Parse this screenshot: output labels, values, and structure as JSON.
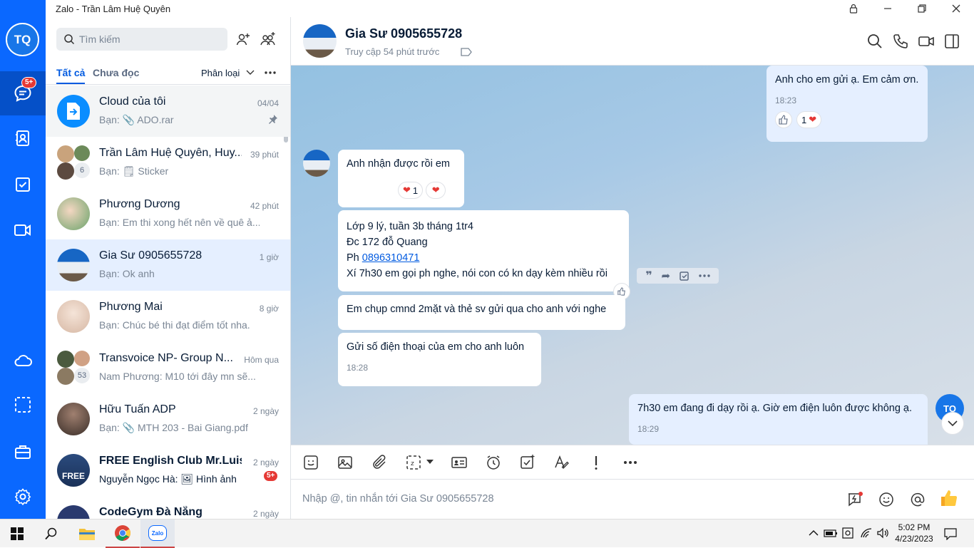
{
  "window": {
    "title": "Zalo - Trần Lâm Huệ Quyên"
  },
  "nav": {
    "avatar_initials": "TQ",
    "chat_badge": "5+"
  },
  "search": {
    "placeholder": "Tìm kiếm"
  },
  "tabs": {
    "all": "Tất cả",
    "unread": "Chưa đọc",
    "classify": "Phân loại"
  },
  "conversations": [
    {
      "name": "Cloud của tôi",
      "time": "04/04",
      "preview": "Bạn: 📎 ADO.rar",
      "pinned": true
    },
    {
      "name": "Trần Lâm Huệ Quyên, Huy...",
      "time": "39 phút",
      "preview": "Bạn: 🗒 Sticker",
      "count": "6"
    },
    {
      "name": "Phương Dương",
      "time": "42 phút",
      "preview": "Bạn: Em thi xong hết nên về quê ả..."
    },
    {
      "name": "Gia Sư 0905655728",
      "time": "1 giờ",
      "preview": "Bạn: Ok anh"
    },
    {
      "name": "Phương Mai",
      "time": "8 giờ",
      "preview": "Bạn: Chúc bé thi đạt điểm tốt nha."
    },
    {
      "name": "Transvoice NP- Group N...",
      "time": "Hôm qua",
      "preview": "Nam Phương: M10 tới đây mn sẽ...",
      "count": "53"
    },
    {
      "name": "Hữu Tuấn ADP",
      "time": "2 ngày",
      "preview": "Bạn: 📎 MTH 203 - Bai Giang.pdf"
    },
    {
      "name": "FREE English Club Mr.Luis...",
      "time": "2 ngày",
      "preview": "Nguyễn Ngọc Hà: 🖼 Hình ảnh",
      "badge": "5+",
      "avatar_text": "FREE"
    },
    {
      "name": "CodeGym Đà Nẵng",
      "time": "2 ngày",
      "preview": ""
    }
  ],
  "chat": {
    "name": "Gia Sư 0905655728",
    "status": "Truy cập 54 phút trước",
    "messages": [
      {
        "text": "Anh cho em gửi ạ. Em cảm ơn.",
        "time": "18:23",
        "reaction_count": "1"
      },
      {
        "text": "Anh nhận được rồi em",
        "reaction_count": "1"
      },
      {
        "line1": "Lớp 9 lý, tuần 3b tháng 1tr4",
        "line2": "Đc  172 đỗ Quang",
        "line3_prefix": "Ph ",
        "phone": "0896310471",
        "line4": "Xí 7h30 em gọi ph nghe, nói con có kn dạy kèm nhiều rồi"
      },
      {
        "text": "Em chụp cmnd 2mặt và thẻ sv gửi qua cho anh với nghe"
      },
      {
        "text": "Gửi số điện thoại của em cho anh luôn",
        "time": "18:28"
      },
      {
        "text": "7h30 em đang đi dạy rồi ạ. Giờ em điện luôn được không ạ.",
        "time": "18:29"
      }
    ],
    "input_placeholder": "Nhập @, tin nhắn tới Gia Sư 0905655728"
  },
  "taskbar": {
    "time": "5:02 PM",
    "date": "4/23/2023",
    "zalo_label": "Zalo"
  }
}
